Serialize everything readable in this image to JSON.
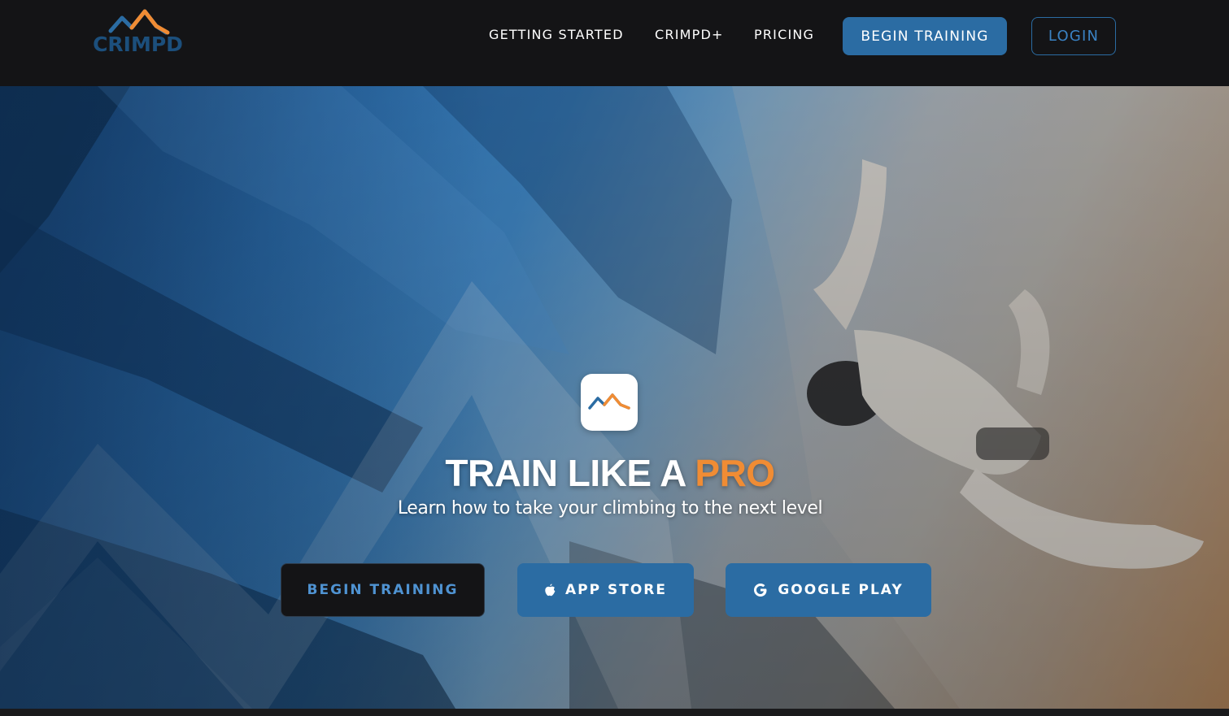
{
  "header": {
    "logo_text": "CRIMPD",
    "nav": {
      "getting_started": "GETTING STARTED",
      "crimpd_plus": "CRIMPD+",
      "pricing": "PRICING"
    },
    "begin_training": "BEGIN TRAINING",
    "login": "LOGIN"
  },
  "hero": {
    "title_main": "TRAIN LIKE A ",
    "title_accent": "PRO",
    "subtitle": "Learn how to take your climbing to the next level",
    "buttons": {
      "begin_training": "BEGIN TRAINING",
      "app_store": "APP STORE",
      "google_play": "GOOGLE PLAY"
    }
  },
  "colors": {
    "brand_blue": "#2b6ca3",
    "brand_orange": "#f08c34",
    "header_bg": "#141416"
  },
  "icons": [
    "crimpd-logo-mark",
    "app-icon",
    "apple-icon",
    "google-icon"
  ]
}
